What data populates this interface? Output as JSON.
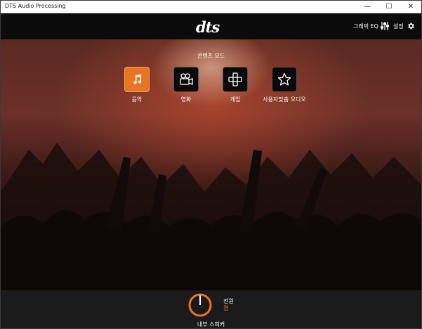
{
  "window": {
    "title": "DTS Audio Processing",
    "minimize": "—",
    "maximize": "☐",
    "close": "✕"
  },
  "header": {
    "logo": "dts",
    "graphic_eq_label": "그래픽 EQ",
    "settings_label": "설정"
  },
  "content_mode": {
    "title": "콘텐츠 모드",
    "modes": [
      {
        "label": "음악",
        "icon": "music-note-icon",
        "active": true
      },
      {
        "label": "영화",
        "icon": "movie-camera-icon",
        "active": false
      },
      {
        "label": "게임",
        "icon": "gamepad-icon",
        "active": false
      },
      {
        "label": "사용자맞춤 오디오",
        "icon": "star-icon",
        "active": false
      }
    ]
  },
  "footer": {
    "power_label": "전원",
    "power_state": "켬",
    "device_label": "내부 스피커"
  },
  "colors": {
    "accent": "#e87524",
    "background": "#0b0b0b",
    "footer": "#1b1b1b"
  }
}
